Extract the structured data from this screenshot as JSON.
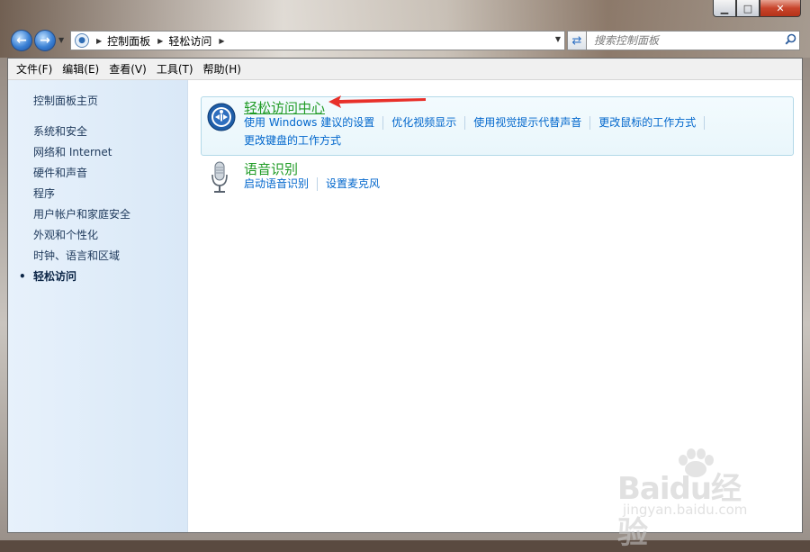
{
  "window": {
    "minimize": "▁",
    "maximize": "□",
    "close": "✕"
  },
  "address": {
    "crumbs": [
      "控制面板",
      "轻松访问"
    ],
    "search_placeholder": "搜索控制面板"
  },
  "menu": [
    "文件(F)",
    "编辑(E)",
    "查看(V)",
    "工具(T)",
    "帮助(H)"
  ],
  "sidebar": {
    "home": "控制面板主页",
    "items": [
      "系统和安全",
      "网络和 Internet",
      "硬件和声音",
      "程序",
      "用户帐户和家庭安全",
      "外观和个性化",
      "时钟、语言和区域",
      "轻松访问"
    ],
    "active": "轻松访问"
  },
  "categories": [
    {
      "title": "轻松访问中心",
      "links": [
        "使用 Windows 建议的设置",
        "优化视频显示",
        "使用视觉提示代替声音",
        "更改鼠标的工作方式",
        "更改键盘的工作方式"
      ]
    },
    {
      "title": "语音识别",
      "links": [
        "启动语音识别",
        "设置麦克风"
      ]
    }
  ],
  "watermark": {
    "text": "Baidu经验",
    "sub": "jingyan.baidu.com"
  },
  "colors": {
    "link": "#0066cc",
    "title": "#1f9b25",
    "sidebar": "#e7f1fb",
    "arrow": "#e8302a"
  },
  "icons": [
    "back-arrow-icon",
    "forward-arrow-icon",
    "control-panel-icon",
    "refresh-icon",
    "search-icon",
    "ease-of-access-icon",
    "microphone-icon"
  ]
}
